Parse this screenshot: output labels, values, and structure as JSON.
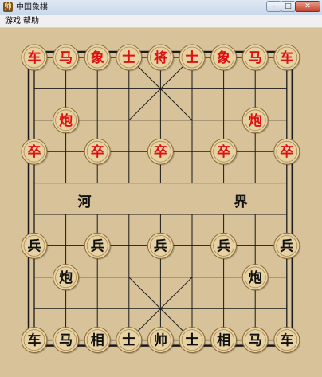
{
  "window": {
    "title": "中国象棋",
    "icon": "chess-app-icon"
  },
  "menu": {
    "game_label": "游戏",
    "help_label": "帮助"
  },
  "board": {
    "river_left": "河",
    "river_right": "界",
    "colors": {
      "background": "#d8c299",
      "line": "#1a1a1a",
      "red": "#e01010",
      "black": "#111111",
      "piece_fill": "#e7d2a4"
    }
  },
  "pieces": {
    "red": [
      {
        "char": "车",
        "col": 0,
        "row": 0
      },
      {
        "char": "马",
        "col": 1,
        "row": 0
      },
      {
        "char": "象",
        "col": 2,
        "row": 0
      },
      {
        "char": "士",
        "col": 3,
        "row": 0
      },
      {
        "char": "将",
        "col": 4,
        "row": 0
      },
      {
        "char": "士",
        "col": 5,
        "row": 0
      },
      {
        "char": "象",
        "col": 6,
        "row": 0
      },
      {
        "char": "马",
        "col": 7,
        "row": 0
      },
      {
        "char": "车",
        "col": 8,
        "row": 0
      },
      {
        "char": "炮",
        "col": 1,
        "row": 2
      },
      {
        "char": "炮",
        "col": 7,
        "row": 2
      },
      {
        "char": "卒",
        "col": 0,
        "row": 3
      },
      {
        "char": "卒",
        "col": 2,
        "row": 3
      },
      {
        "char": "卒",
        "col": 4,
        "row": 3
      },
      {
        "char": "卒",
        "col": 6,
        "row": 3
      },
      {
        "char": "卒",
        "col": 8,
        "row": 3
      }
    ],
    "black": [
      {
        "char": "兵",
        "col": 0,
        "row": 6
      },
      {
        "char": "兵",
        "col": 2,
        "row": 6
      },
      {
        "char": "兵",
        "col": 4,
        "row": 6
      },
      {
        "char": "兵",
        "col": 6,
        "row": 6
      },
      {
        "char": "兵",
        "col": 8,
        "row": 6
      },
      {
        "char": "炮",
        "col": 1,
        "row": 7
      },
      {
        "char": "炮",
        "col": 7,
        "row": 7
      },
      {
        "char": "车",
        "col": 0,
        "row": 9
      },
      {
        "char": "马",
        "col": 1,
        "row": 9
      },
      {
        "char": "相",
        "col": 2,
        "row": 9
      },
      {
        "char": "士",
        "col": 3,
        "row": 9
      },
      {
        "char": "帅",
        "col": 4,
        "row": 9
      },
      {
        "char": "士",
        "col": 5,
        "row": 9
      },
      {
        "char": "相",
        "col": 6,
        "row": 9
      },
      {
        "char": "马",
        "col": 7,
        "row": 9
      },
      {
        "char": "车",
        "col": 8,
        "row": 9
      }
    ]
  }
}
